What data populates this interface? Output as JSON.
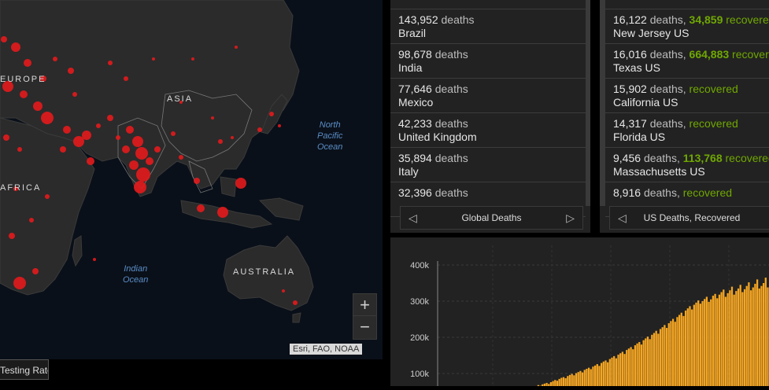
{
  "map": {
    "labels": {
      "europe": "EUROPE",
      "asia": "ASIA",
      "africa": "AFRICA",
      "australia": "AUSTRALIA"
    },
    "oceans": {
      "north_pacific": [
        "North",
        "Pacific",
        "Ocean"
      ],
      "indian": [
        "Indian",
        "Ocean"
      ]
    },
    "zoom_in": "+",
    "zoom_out": "−",
    "attribution": "Esri, FAO, NOAA",
    "bottom_tab": "Testing Rate"
  },
  "global_deaths": {
    "nav_label": "Global Deaths",
    "unit": "deaths",
    "items": [
      {
        "count": "143,952",
        "place": "Brazil"
      },
      {
        "count": "98,678",
        "place": "India"
      },
      {
        "count": "77,646",
        "place": "Mexico"
      },
      {
        "count": "42,233",
        "place": "United Kingdom"
      },
      {
        "count": "35,894",
        "place": "Italy"
      },
      {
        "count": "32,396",
        "place": ""
      }
    ]
  },
  "us_deaths": {
    "nav_label": "US Deaths, Recovered",
    "death_unit": "deaths,",
    "recovered_unit": "recovered",
    "items": [
      {
        "deaths": "16,122",
        "recovered": "34,859",
        "place": "New Jersey US"
      },
      {
        "deaths": "16,016",
        "recovered": "664,883",
        "place": "Texas US"
      },
      {
        "deaths": "15,902",
        "recovered": "",
        "place": "California US"
      },
      {
        "deaths": "14,317",
        "recovered": "",
        "place": "Florida US"
      },
      {
        "deaths": "9,456",
        "recovered": "113,768",
        "place": "Massachusetts US"
      },
      {
        "deaths": "8,916",
        "recovered": "",
        "place": ""
      }
    ]
  },
  "colors": {
    "bubble": "#e31a1c",
    "bar": "#f5a623",
    "recovered": "#70a800"
  },
  "chart_data": {
    "type": "bar",
    "ylabel": "",
    "xlabel": "",
    "title": "",
    "y_ticks": [
      "100k",
      "200k",
      "300k",
      "400k"
    ],
    "ylim": [
      50000,
      420000
    ],
    "series": [
      {
        "values": [
          52000,
          54000,
          53000,
          56000,
          58000,
          55000,
          60000,
          62000,
          61000,
          65000,
          68000,
          66000,
          70000,
          72000,
          74000,
          71000,
          76000,
          79000,
          82000,
          80000,
          85000,
          88000,
          90000,
          87000,
          93000,
          96000,
          99000,
          95000,
          101000,
          104000,
          107000,
          103000,
          110000,
          113000,
          116000,
          112000,
          119000,
          122000,
          126000,
          121000,
          129000,
          133000,
          136000,
          131000,
          140000,
          144000,
          148000,
          142000,
          152000,
          156000,
          160000,
          154000,
          165000,
          169000,
          173000,
          167000,
          178000,
          183000,
          187000,
          180000,
          192000,
          197000,
          202000,
          195000,
          207000,
          212000,
          218000,
          210000,
          223000,
          228000,
          234000,
          226000,
          239000,
          245000,
          251000,
          243000,
          256000,
          262000,
          268000,
          259000,
          274000,
          280000,
          286000,
          277000,
          290000,
          296000,
          302000,
          293000,
          300000,
          306000,
          312000,
          298000,
          305000,
          315000,
          320000,
          308000,
          318000,
          325000,
          332000,
          312000,
          322000,
          330000,
          340000,
          318000,
          328000,
          335000,
          345000,
          325000,
          333000,
          342000,
          352000,
          330000,
          338000,
          348000,
          360000,
          335000,
          342000,
          350000,
          365000,
          338000
        ]
      }
    ]
  }
}
